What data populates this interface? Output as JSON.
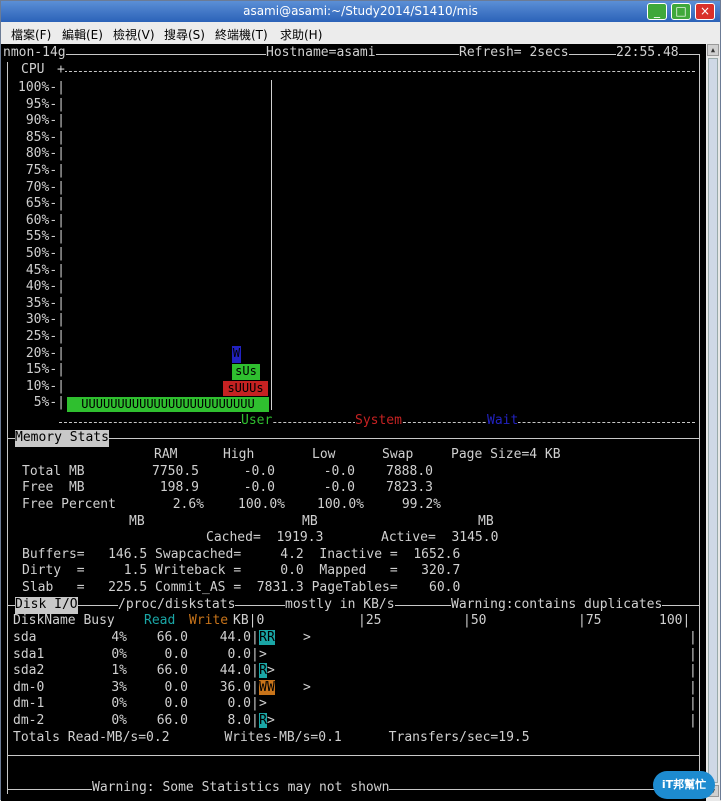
{
  "window": {
    "title": "asami@asami:~/Study2014/S1410/mis",
    "min_glyph": "_",
    "max_glyph": "□",
    "close_glyph": "×"
  },
  "menu": [
    "檔案(F)",
    "編輯(E)",
    "檢視(V)",
    "搜尋(S)",
    "終端機(T)",
    "求助(H)"
  ],
  "header": {
    "version": "nmon-14g",
    "hostname": "Hostname=asami",
    "refresh": "Refresh= 2secs",
    "time": "22:55.48"
  },
  "cpu": {
    "title": "CPU",
    "ylabels": [
      "100%-|",
      "95%-|",
      "90%-|",
      "85%-|",
      "80%-|",
      "75%-|",
      "70%-|",
      "65%-|",
      "60%-|",
      "55%-|",
      "50%-|",
      "45%-|",
      "40%-|",
      "35%-|",
      "30%-|",
      "25%-|",
      "20%-|",
      "15%-|",
      "10%-|",
      "5%-|"
    ],
    "user_bar": "UUUUUUUUUUUUUUUUUUUUUUUU",
    "spike_10": "sUUUs",
    "spike_15": "sUs",
    "spike_20": "W",
    "legend": {
      "user": "User",
      "system": "System",
      "wait": "Wait"
    },
    "colors": {
      "user": "#2fbf2f",
      "system": "#c52222",
      "wait": "#2222c0"
    }
  },
  "memory": {
    "title": "Memory Stats",
    "headers": [
      "RAM",
      "High",
      "Low",
      "Swap",
      "Page Size=4 KB"
    ],
    "rows": [
      {
        "label": "Total MB",
        "ram": "7750.5",
        "high": "-0.0",
        "low": "-0.0",
        "swap": "7888.0"
      },
      {
        "label": "Free  MB",
        "ram": "198.9",
        "high": "-0.0",
        "low": "-0.0",
        "swap": "7823.3"
      },
      {
        "label": "Free Percent",
        "ram": "2.6%",
        "high": "100.0%",
        "low": "100.0%",
        "swap": "99.2%"
      }
    ],
    "mb_headers": [
      "MB",
      "MB",
      "MB"
    ],
    "cached": "Cached=  1919.3",
    "active": "Active=  3145.0",
    "lines": [
      "Buffers=   146.5 Swapcached=     4.2  Inactive =  1652.6",
      "Dirty  =     1.5 Writeback =     0.0  Mapped   =   320.7",
      "Slab   =   225.5 Commit_AS =  7831.3 PageTables=    60.0"
    ]
  },
  "disk": {
    "title": "Disk I/O",
    "source": "/proc/diskstats",
    "units": "mostly in KB/s",
    "warning": "Warning:contains duplicates",
    "col_name": "DiskName Busy",
    "col_read": "Read",
    "col_write": "Write",
    "col_kb": "KB|0",
    "scale": [
      "|25",
      "|50",
      "|75",
      "100|"
    ],
    "rows": [
      {
        "name": "sda",
        "busy": "4%",
        "read": "66.0",
        "write": "44.0",
        "bar": "RR",
        "mark": ">"
      },
      {
        "name": "sda1",
        "busy": "0%",
        "read": "0.0",
        "write": "0.0",
        "bar": "",
        "mark": ">"
      },
      {
        "name": "sda2",
        "busy": "1%",
        "read": "66.0",
        "write": "44.0",
        "bar": "R",
        "mark": ">"
      },
      {
        "name": "dm-0",
        "busy": "3%",
        "read": "0.0",
        "write": "36.0",
        "bar": "WW",
        "mark": ">"
      },
      {
        "name": "dm-1",
        "busy": "0%",
        "read": "0.0",
        "write": "0.0",
        "bar": "",
        "mark": ">"
      },
      {
        "name": "dm-2",
        "busy": "0%",
        "read": "66.0",
        "write": "8.0",
        "bar": "R",
        "mark": ">"
      }
    ],
    "totals": "Totals Read-MB/s=0.2       Writes-MB/s=0.1      Transfers/sec=19.5",
    "colors": {
      "read": "#1aa6a6",
      "write": "#c8741a"
    }
  },
  "footer": "Warning: Some Statistics may not shown",
  "badge": "iT邦幫忙"
}
